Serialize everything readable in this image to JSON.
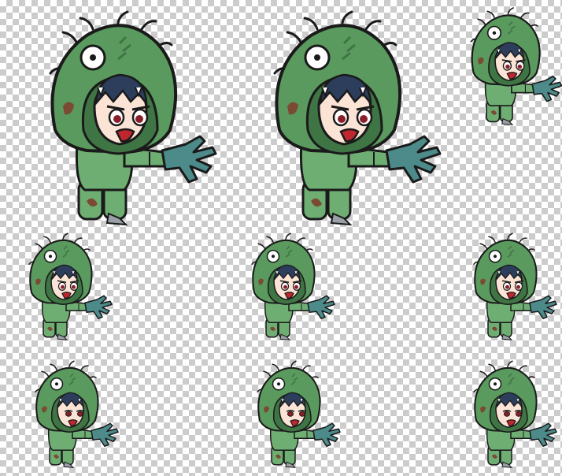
{
  "sheet": {
    "background": "transparency-checkerboard",
    "frames": [
      {
        "id": "frame-1",
        "pose": "reach",
        "eyes": "open"
      },
      {
        "id": "frame-2",
        "pose": "reach",
        "eyes": "open"
      },
      {
        "id": "frame-3",
        "pose": "reach",
        "eyes": "open"
      },
      {
        "id": "frame-4",
        "pose": "reach",
        "eyes": "open"
      },
      {
        "id": "frame-5",
        "pose": "reach",
        "eyes": "open"
      },
      {
        "id": "frame-6",
        "pose": "reach",
        "eyes": "open"
      },
      {
        "id": "frame-7",
        "pose": "reach",
        "eyes": "squint"
      },
      {
        "id": "frame-8",
        "pose": "reach",
        "eyes": "squint"
      },
      {
        "id": "frame-9",
        "pose": "reach",
        "eyes": "squint"
      }
    ]
  },
  "colors": {
    "hood": "#5a9a5e",
    "hood_dark": "#3f7444",
    "suit": "#6fae73",
    "hand": "#4d8a8a",
    "hair": "#2c3e5c",
    "skin": "#fbe3d6",
    "patch": "#7a4a33",
    "outline": "#1a1a1a"
  }
}
